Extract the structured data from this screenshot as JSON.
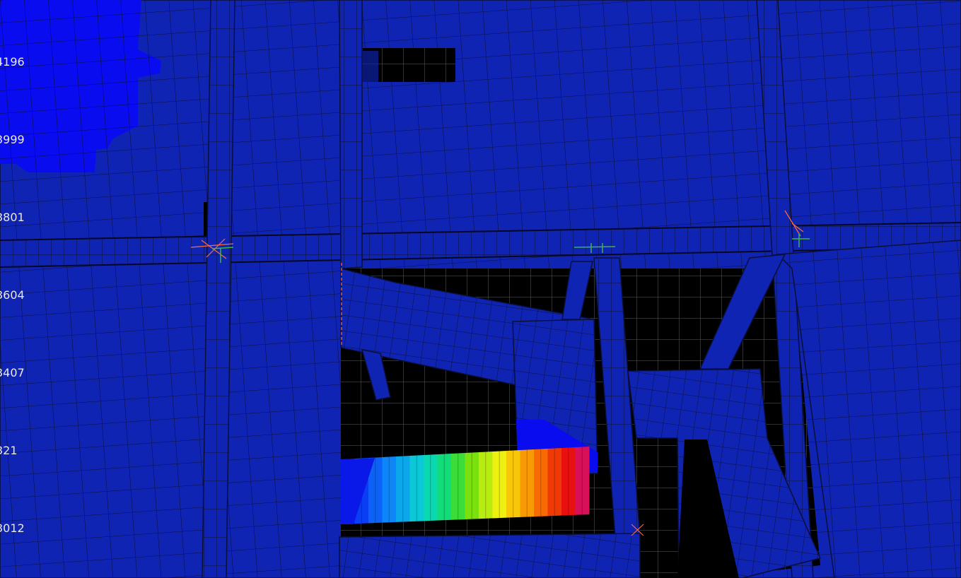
{
  "viewport": {
    "name": "fea-mesh-stress-contour-view",
    "background_color": "#000000",
    "mesh_fill_color": "#1024b4",
    "mesh_edge_color": "#0a0f3a",
    "highlight_region_color": "#0a0cf0",
    "construction_line_color": "#6a6a6a",
    "constraint_marker_color": "#ff6a3c",
    "constraint_axis_color": "#3fb53f"
  },
  "legend": {
    "labels": [
      "4196",
      "3999",
      "3801",
      "3604",
      "3407",
      "321",
      "3012"
    ]
  },
  "contour": {
    "color_scale": [
      "#0a18e8",
      "#0a3ef4",
      "#0c62f6",
      "#0c86f8",
      "#0aa8ea",
      "#0ac8d6",
      "#0ad8b0",
      "#12dc78",
      "#3cdc3a",
      "#7ae00e",
      "#b8ec10",
      "#eef010",
      "#f8c808",
      "#f89a04",
      "#f86a02",
      "#f03a06",
      "#e81010",
      "#d8105a"
    ]
  }
}
